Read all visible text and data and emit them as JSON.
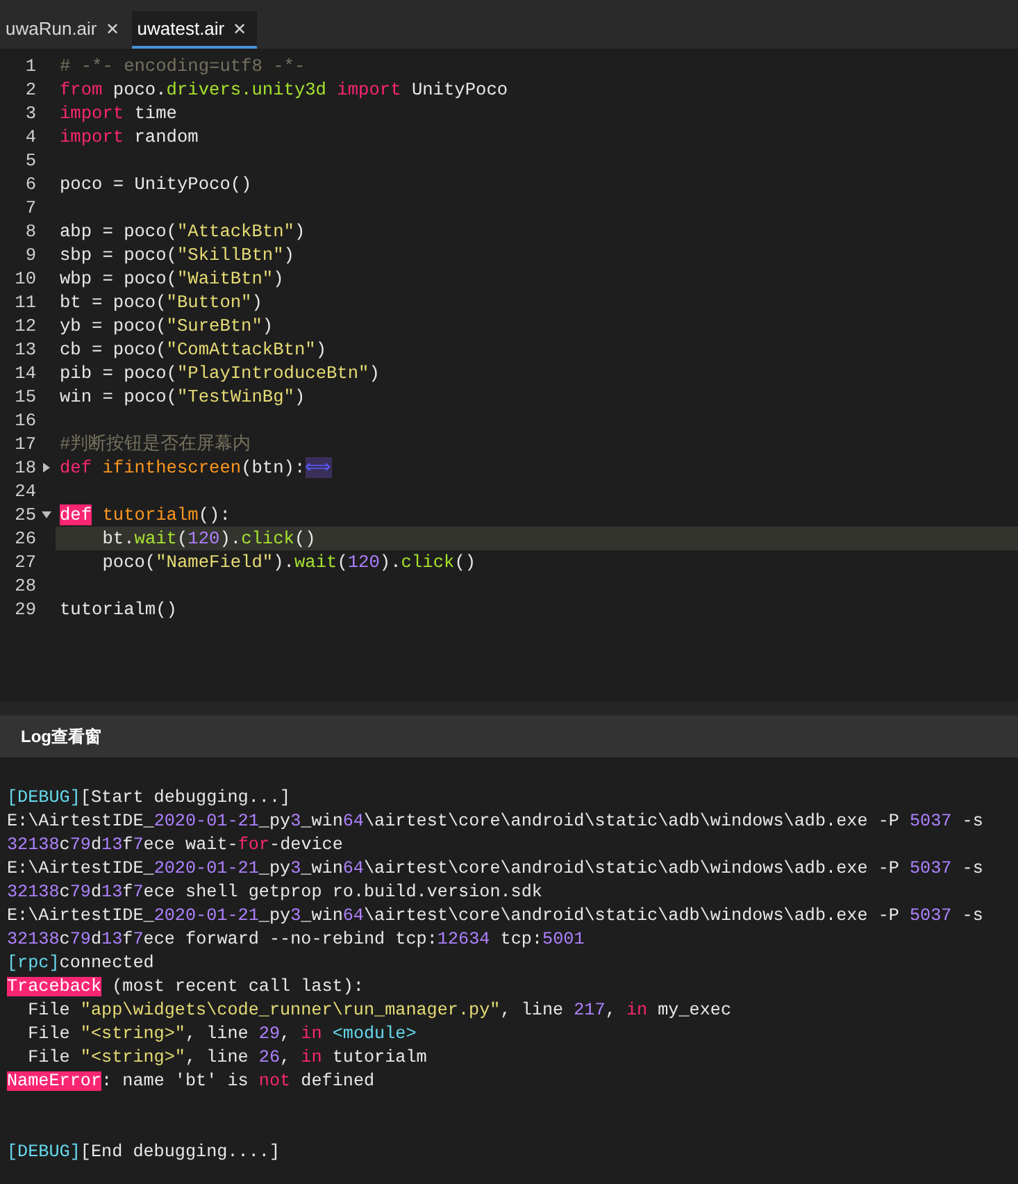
{
  "tabs": [
    {
      "label": "uwaRun.air",
      "selected": false,
      "close": "✕"
    },
    {
      "label": "uwatest.air",
      "selected": true,
      "close": "✕"
    }
  ],
  "editor": {
    "lines": [
      {
        "number": "1",
        "current": false,
        "tokens": [
          {
            "kind": "comment",
            "text": "# -*- encoding=utf8 -*-"
          }
        ]
      },
      {
        "number": "2",
        "current": false,
        "tokens": [
          {
            "kind": "keyword",
            "text": "from"
          },
          {
            "kind": "plain",
            "text": " poco."
          },
          {
            "kind": "call",
            "text": "drivers.unity3d"
          },
          {
            "kind": "keyword",
            "text": " import"
          },
          {
            "kind": "plain",
            "text": " UnityPoco"
          }
        ]
      },
      {
        "number": "3",
        "current": false,
        "tokens": [
          {
            "kind": "keyword",
            "text": "import"
          },
          {
            "kind": "plain",
            "text": " time"
          }
        ]
      },
      {
        "number": "4",
        "current": false,
        "tokens": [
          {
            "kind": "keyword",
            "text": "import"
          },
          {
            "kind": "plain",
            "text": " random"
          }
        ]
      },
      {
        "number": "5",
        "current": false
      },
      {
        "number": "6",
        "current": false,
        "tokens": [
          {
            "kind": "plain",
            "text": "poco = UnityPoco()"
          }
        ]
      },
      {
        "number": "7",
        "current": false
      },
      {
        "number": "8",
        "current": false,
        "tokens": [
          {
            "kind": "plain",
            "text": "abp = poco("
          },
          {
            "kind": "string",
            "text": "\"AttackBtn\""
          },
          {
            "kind": "plain",
            "text": ")"
          }
        ]
      },
      {
        "number": "9",
        "current": false,
        "tokens": [
          {
            "kind": "plain",
            "text": "sbp = poco("
          },
          {
            "kind": "string",
            "text": "\"SkillBtn\""
          },
          {
            "kind": "plain",
            "text": ")"
          }
        ]
      },
      {
        "number": "10",
        "current": false,
        "tokens": [
          {
            "kind": "plain",
            "text": "wbp = poco("
          },
          {
            "kind": "string",
            "text": "\"WaitBtn\""
          },
          {
            "kind": "plain",
            "text": ")"
          }
        ]
      },
      {
        "number": "11",
        "current": false,
        "tokens": [
          {
            "kind": "plain",
            "text": "bt = poco("
          },
          {
            "kind": "string",
            "text": "\"Button\""
          },
          {
            "kind": "plain",
            "text": ")"
          }
        ]
      },
      {
        "number": "12",
        "current": false,
        "tokens": [
          {
            "kind": "plain",
            "text": "yb = poco("
          },
          {
            "kind": "string",
            "text": "\"SureBtn\""
          },
          {
            "kind": "plain",
            "text": ")"
          }
        ]
      },
      {
        "number": "13",
        "current": false,
        "tokens": [
          {
            "kind": "plain",
            "text": "cb = poco("
          },
          {
            "kind": "string",
            "text": "\"ComAttackBtn\""
          },
          {
            "kind": "plain",
            "text": ")"
          }
        ]
      },
      {
        "number": "14",
        "current": false,
        "tokens": [
          {
            "kind": "plain",
            "text": "pib = poco("
          },
          {
            "kind": "string",
            "text": "\"PlayIntroduceBtn\""
          },
          {
            "kind": "plain",
            "text": ")"
          }
        ]
      },
      {
        "number": "15",
        "current": false,
        "tokens": [
          {
            "kind": "plain",
            "text": "win = poco("
          },
          {
            "kind": "string",
            "text": "\"TestWinBg\""
          },
          {
            "kind": "plain",
            "text": ")"
          }
        ]
      },
      {
        "number": "16",
        "current": false
      },
      {
        "number": "17",
        "current": false,
        "tokens": [
          {
            "kind": "comment",
            "text": "#判断按钮是否在屏幕内"
          }
        ]
      },
      {
        "number": "18",
        "expanded": false,
        "current": false,
        "tokens": [
          {
            "kind": "keyword",
            "text": "def"
          },
          {
            "kind": "name",
            "text": " ifinthescreen"
          },
          {
            "kind": "plain",
            "text": "(btn):"
          },
          {
            "kind": "folded",
            "text": "⟺"
          }
        ]
      },
      {
        "number": "24",
        "current": false
      },
      {
        "number": "25",
        "expanded": true,
        "current": false,
        "tokens": [
          {
            "kind": "match",
            "text": "def"
          },
          {
            "kind": "name",
            "text": " tutorialm"
          },
          {
            "kind": "plain",
            "text": "():"
          }
        ]
      },
      {
        "number": "26",
        "current": true,
        "tokens": [
          {
            "kind": "plain",
            "text": "    bt."
          },
          {
            "kind": "call",
            "text": "wait"
          },
          {
            "kind": "plain",
            "text": "("
          },
          {
            "kind": "number",
            "text": "120"
          },
          {
            "kind": "plain",
            "text": ")."
          },
          {
            "kind": "call",
            "text": "click"
          },
          {
            "kind": "plain",
            "text": "()"
          }
        ]
      },
      {
        "number": "27",
        "current": false,
        "tokens": [
          {
            "kind": "plain",
            "text": "    poco("
          },
          {
            "kind": "string",
            "text": "\"NameField\""
          },
          {
            "kind": "plain",
            "text": ")."
          },
          {
            "kind": "call",
            "text": "wait"
          },
          {
            "kind": "plain",
            "text": "("
          },
          {
            "kind": "number",
            "text": "120"
          },
          {
            "kind": "plain",
            "text": ")."
          },
          {
            "kind": "call",
            "text": "click"
          },
          {
            "kind": "plain",
            "text": "()"
          }
        ]
      },
      {
        "number": "28",
        "current": false
      },
      {
        "number": "29",
        "current": false,
        "tokens": [
          {
            "kind": "plain",
            "text": "tutorialm()"
          }
        ]
      }
    ]
  },
  "log_panel": {
    "title": "Log查看窗",
    "lines": [
      {
        "kind": "text",
        "tokens": [
          {
            "kind": "builtin",
            "text": "[DEBUG]"
          },
          {
            "kind": "plain",
            "text": "[Start debugging...]"
          }
        ]
      },
      {
        "kind": "text",
        "tokens": [
          {
            "kind": "plain",
            "text": "E:\\AirtestIDE_"
          },
          {
            "kind": "number",
            "text": "2020-01-21"
          },
          {
            "kind": "plain",
            "text": "_py"
          },
          {
            "kind": "number",
            "text": "3"
          },
          {
            "kind": "plain",
            "text": "_win"
          },
          {
            "kind": "number",
            "text": "64"
          },
          {
            "kind": "plain",
            "text": "\\airtest\\core\\android\\static\\adb\\windows\\adb.exe -P "
          },
          {
            "kind": "number",
            "text": "5037"
          },
          {
            "kind": "plain",
            "text": " -s"
          }
        ]
      },
      {
        "kind": "text",
        "tokens": [
          {
            "kind": "number",
            "text": "32138"
          },
          {
            "kind": "plain",
            "text": "c"
          },
          {
            "kind": "number",
            "text": "79"
          },
          {
            "kind": "plain",
            "text": "d"
          },
          {
            "kind": "number",
            "text": "13"
          },
          {
            "kind": "plain",
            "text": "f"
          },
          {
            "kind": "number",
            "text": "7"
          },
          {
            "kind": "plain",
            "text": "ece wait-"
          },
          {
            "kind": "keyword",
            "text": "for"
          },
          {
            "kind": "plain",
            "text": "-device"
          }
        ]
      },
      {
        "kind": "text",
        "tokens": [
          {
            "kind": "plain",
            "text": "E:\\AirtestIDE_"
          },
          {
            "kind": "number",
            "text": "2020-01-21"
          },
          {
            "kind": "plain",
            "text": "_py"
          },
          {
            "kind": "number",
            "text": "3"
          },
          {
            "kind": "plain",
            "text": "_win"
          },
          {
            "kind": "number",
            "text": "64"
          },
          {
            "kind": "plain",
            "text": "\\airtest\\core\\android\\static\\adb\\windows\\adb.exe -P "
          },
          {
            "kind": "number",
            "text": "5037"
          },
          {
            "kind": "plain",
            "text": " -s"
          }
        ]
      },
      {
        "kind": "text",
        "tokens": [
          {
            "kind": "number",
            "text": "32138"
          },
          {
            "kind": "plain",
            "text": "c"
          },
          {
            "kind": "number",
            "text": "79"
          },
          {
            "kind": "plain",
            "text": "d"
          },
          {
            "kind": "number",
            "text": "13"
          },
          {
            "kind": "plain",
            "text": "f"
          },
          {
            "kind": "number",
            "text": "7"
          },
          {
            "kind": "plain",
            "text": "ece shell getprop ro.build.version.sdk"
          }
        ]
      },
      {
        "kind": "text",
        "tokens": [
          {
            "kind": "plain",
            "text": "E:\\AirtestIDE_"
          },
          {
            "kind": "number",
            "text": "2020-01-21"
          },
          {
            "kind": "plain",
            "text": "_py"
          },
          {
            "kind": "number",
            "text": "3"
          },
          {
            "kind": "plain",
            "text": "_win"
          },
          {
            "kind": "number",
            "text": "64"
          },
          {
            "kind": "plain",
            "text": "\\airtest\\core\\android\\static\\adb\\windows\\adb.exe -P "
          },
          {
            "kind": "number",
            "text": "5037"
          },
          {
            "kind": "plain",
            "text": " -s"
          }
        ]
      },
      {
        "kind": "text",
        "tokens": [
          {
            "kind": "number",
            "text": "32138"
          },
          {
            "kind": "plain",
            "text": "c"
          },
          {
            "kind": "number",
            "text": "79"
          },
          {
            "kind": "plain",
            "text": "d"
          },
          {
            "kind": "number",
            "text": "13"
          },
          {
            "kind": "plain",
            "text": "f"
          },
          {
            "kind": "number",
            "text": "7"
          },
          {
            "kind": "plain",
            "text": "ece forward --no-rebind tcp:"
          },
          {
            "kind": "number",
            "text": "12634"
          },
          {
            "kind": "plain",
            "text": " tcp:"
          },
          {
            "kind": "number",
            "text": "5001"
          }
        ]
      },
      {
        "kind": "text",
        "tokens": [
          {
            "kind": "builtin",
            "text": "[rpc]"
          },
          {
            "kind": "plain",
            "text": "connected"
          }
        ]
      },
      {
        "kind": "text",
        "tokens": [
          {
            "kind": "error",
            "text": "Traceback"
          },
          {
            "kind": "plain",
            "text": " (most recent call last):"
          }
        ]
      },
      {
        "kind": "text",
        "tokens": [
          {
            "kind": "plain",
            "text": "  File "
          },
          {
            "kind": "string",
            "text": "\"app\\widgets\\code_runner\\run_manager.py\""
          },
          {
            "kind": "plain",
            "text": ", line "
          },
          {
            "kind": "number",
            "text": "217"
          },
          {
            "kind": "plain",
            "text": ", "
          },
          {
            "kind": "keyword",
            "text": "in"
          },
          {
            "kind": "plain",
            "text": " my_exec"
          }
        ]
      },
      {
        "kind": "text",
        "tokens": [
          {
            "kind": "plain",
            "text": "  File "
          },
          {
            "kind": "string",
            "text": "\"<string>\""
          },
          {
            "kind": "plain",
            "text": ", line "
          },
          {
            "kind": "number",
            "text": "29"
          },
          {
            "kind": "plain",
            "text": ", "
          },
          {
            "kind": "keyword",
            "text": "in"
          },
          {
            "kind": "builtin",
            "text": " <module>"
          }
        ]
      },
      {
        "kind": "text",
        "tokens": [
          {
            "kind": "plain",
            "text": "  File "
          },
          {
            "kind": "string",
            "text": "\"<string>\""
          },
          {
            "kind": "plain",
            "text": ", line "
          },
          {
            "kind": "number",
            "text": "26"
          },
          {
            "kind": "plain",
            "text": ", "
          },
          {
            "kind": "keyword",
            "text": "in"
          },
          {
            "kind": "plain",
            "text": " tutorialm"
          }
        ]
      },
      {
        "kind": "text",
        "tokens": [
          {
            "kind": "error",
            "text": "NameError"
          },
          {
            "kind": "plain",
            "text": ": name 'bt' is "
          },
          {
            "kind": "keyword",
            "text": "not"
          },
          {
            "kind": "plain",
            "text": " defined"
          }
        ]
      },
      {
        "kind": "blank"
      },
      {
        "kind": "blank"
      },
      {
        "kind": "text",
        "tokens": [
          {
            "kind": "builtin",
            "text": "[DEBUG]"
          },
          {
            "kind": "plain",
            "text": "[End debugging....]"
          }
        ]
      }
    ]
  }
}
